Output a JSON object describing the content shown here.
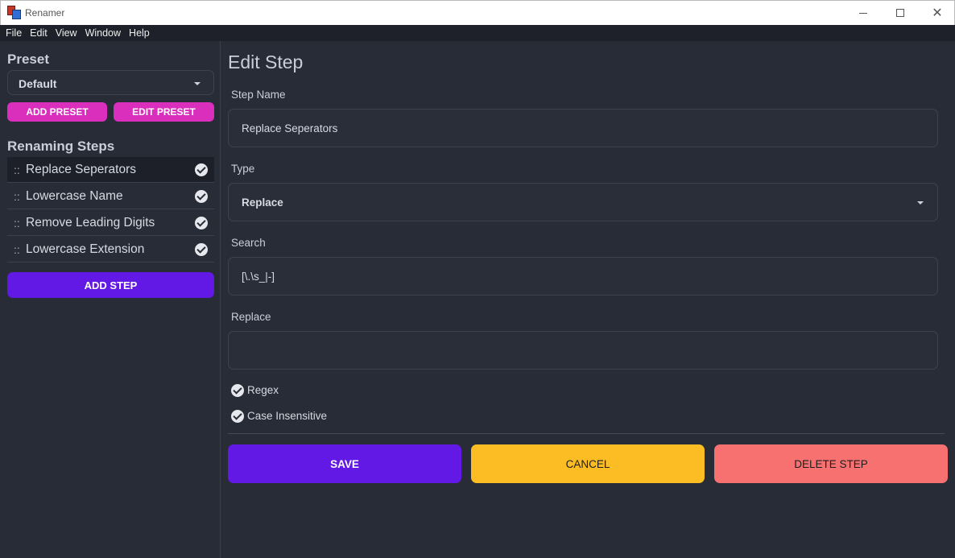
{
  "window": {
    "title": "Renamer"
  },
  "menu": [
    "File",
    "Edit",
    "View",
    "Window",
    "Help"
  ],
  "sidebar": {
    "preset_heading": "Preset",
    "preset_value": "Default",
    "add_preset": "ADD PRESET",
    "edit_preset": "EDIT PRESET",
    "steps_heading": "Renaming Steps",
    "drag_glyph": "::",
    "steps": [
      {
        "label": "Replace Seperators",
        "enabled": true,
        "selected": true
      },
      {
        "label": "Lowercase Name",
        "enabled": true,
        "selected": false
      },
      {
        "label": "Remove Leading Digits",
        "enabled": true,
        "selected": false
      },
      {
        "label": "Lowercase Extension",
        "enabled": true,
        "selected": false
      }
    ],
    "add_step": "ADD STEP"
  },
  "editor": {
    "title": "Edit Step",
    "step_name_label": "Step Name",
    "step_name_value": "Replace Seperators",
    "type_label": "Type",
    "type_value": "Replace",
    "search_label": "Search",
    "search_value": "[\\.\\s_|-]",
    "replace_label": "Replace",
    "replace_value": "",
    "regex_label": "Regex",
    "regex_checked": true,
    "case_label": "Case Insensitive",
    "case_checked": true,
    "save": "SAVE",
    "cancel": "CANCEL",
    "delete": "DELETE STEP"
  },
  "colors": {
    "background": "#282c37",
    "primary": "#6319e6",
    "accent_pink": "#d92fbc",
    "warning": "#fbbd23",
    "error": "#f87171"
  }
}
